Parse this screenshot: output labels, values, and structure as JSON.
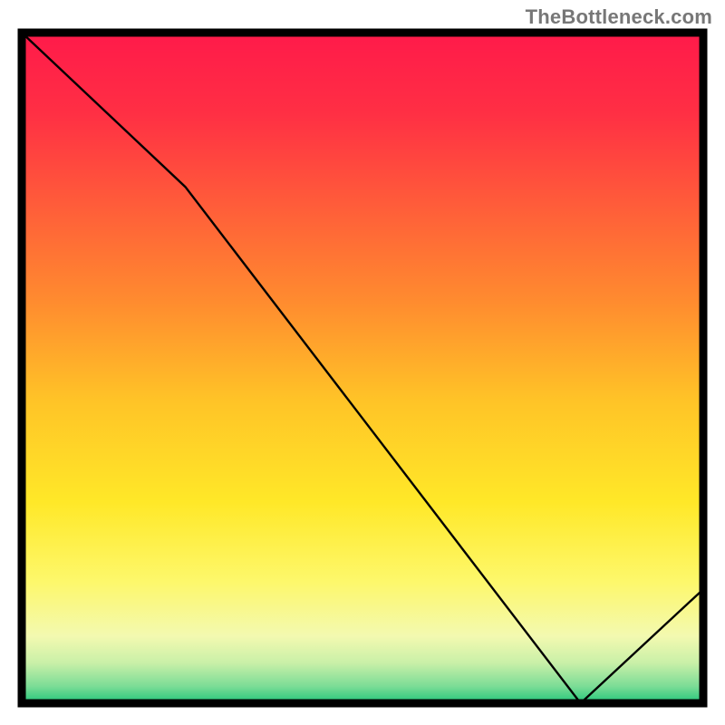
{
  "watermark": "TheBottleneck.com",
  "chart_data": {
    "type": "line",
    "x": [
      0.0,
      0.24,
      0.82,
      1.0
    ],
    "values": [
      1.0,
      0.77,
      0.0,
      0.17
    ],
    "title": "",
    "xlabel": "",
    "ylabel": "",
    "xlim": [
      0,
      1
    ],
    "ylim": [
      0,
      1
    ],
    "annotation_text": "",
    "annotation_pos": [
      0.77,
      0.02
    ],
    "gradient_stops": [
      {
        "offset": 0.0,
        "color": "#ff1a4a"
      },
      {
        "offset": 0.12,
        "color": "#ff2f44"
      },
      {
        "offset": 0.25,
        "color": "#ff5a3a"
      },
      {
        "offset": 0.4,
        "color": "#ff8b2f"
      },
      {
        "offset": 0.55,
        "color": "#ffc427"
      },
      {
        "offset": 0.7,
        "color": "#ffe828"
      },
      {
        "offset": 0.82,
        "color": "#fdf86c"
      },
      {
        "offset": 0.9,
        "color": "#f3f9b0"
      },
      {
        "offset": 0.94,
        "color": "#c9f0a8"
      },
      {
        "offset": 0.975,
        "color": "#7bdc96"
      },
      {
        "offset": 1.0,
        "color": "#22c77a"
      }
    ],
    "border_color": "#000000",
    "line_color": "#000000"
  }
}
